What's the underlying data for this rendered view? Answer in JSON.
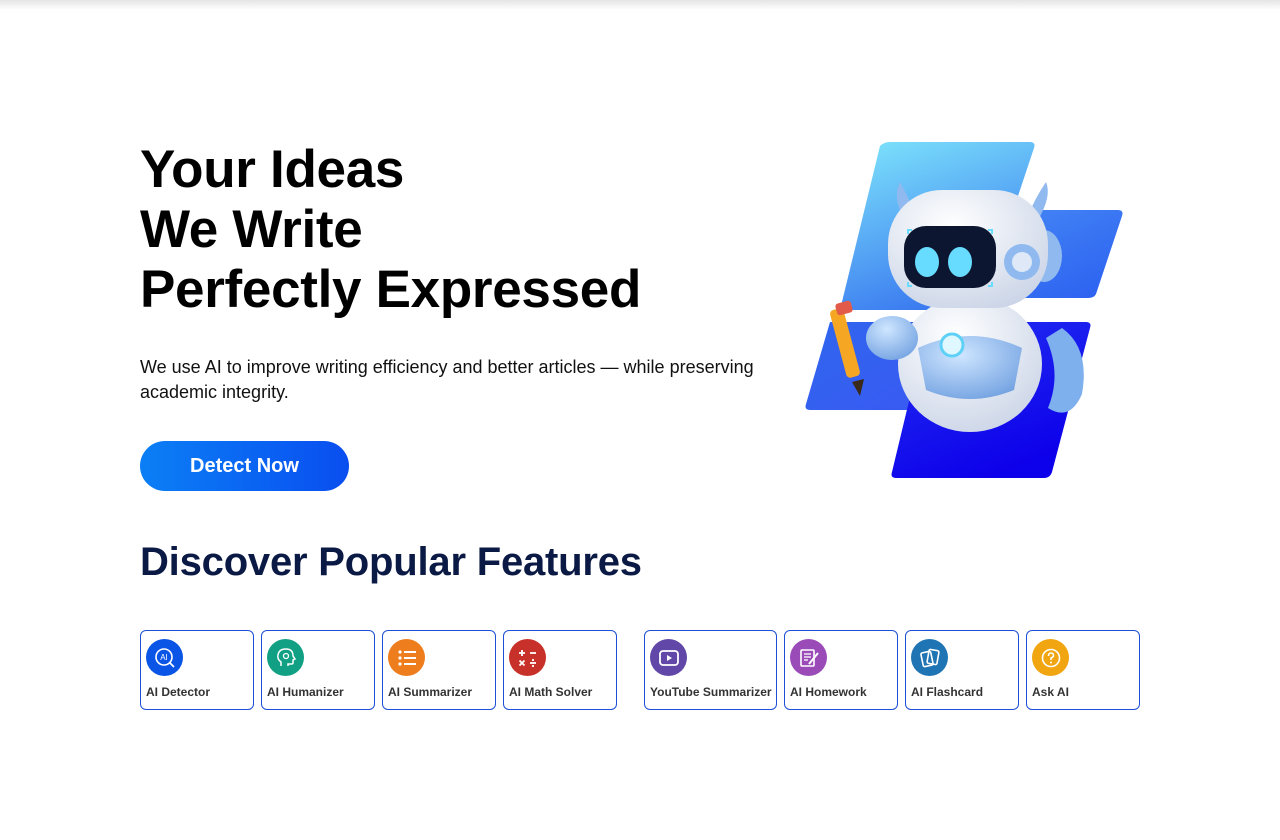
{
  "hero": {
    "title_lines": [
      "Your Ideas",
      "We Write",
      "Perfectly Expressed"
    ],
    "description": "We use AI to improve writing efficiency and better articles — while preserving academic integrity.",
    "cta_label": "Detect Now"
  },
  "features": {
    "title": "Discover Popular Features",
    "items": [
      {
        "label": "AI Detector",
        "icon": "ai-detector-icon",
        "color": "#0a55e6"
      },
      {
        "label": "AI Humanizer",
        "icon": "ai-humanizer-icon",
        "color": "#12a085"
      },
      {
        "label": "AI Summarizer",
        "icon": "ai-summarizer-icon",
        "color": "#ee7d1d"
      },
      {
        "label": "AI Math Solver",
        "icon": "ai-math-solver-icon",
        "color": "#c8312a"
      },
      {
        "label": "YouTube Summarizer",
        "icon": "youtube-summarizer-icon",
        "color": "#6148a8"
      },
      {
        "label": "AI Homework",
        "icon": "ai-homework-icon",
        "color": "#9b4bb8"
      },
      {
        "label": "AI Flashcard",
        "icon": "ai-flashcard-icon",
        "color": "#1f74b4"
      },
      {
        "label": "Ask AI",
        "icon": "ask-ai-icon",
        "color": "#f0a511"
      }
    ]
  },
  "colors": {
    "heading_dark": "#0b1a45",
    "card_border": "#1c4fd6",
    "cta_start": "#0b7ff5",
    "cta_end": "#0a4ef0"
  }
}
